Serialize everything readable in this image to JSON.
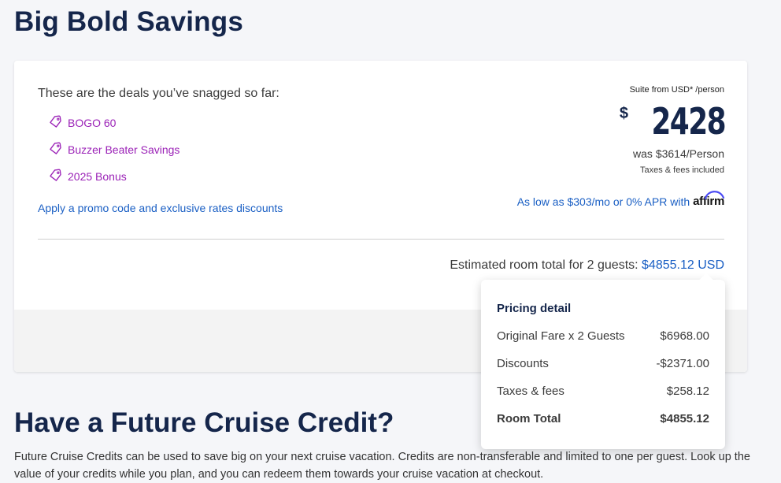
{
  "page": {
    "title": "Big Bold Savings"
  },
  "deals": {
    "intro": "These are the deals you’ve snagged so far:",
    "items": [
      {
        "label": "BOGO 60",
        "icon": "tag-icon"
      },
      {
        "label": "Buzzer Beater Savings",
        "icon": "tag-icon"
      },
      {
        "label": "2025 Bonus",
        "icon": "tag-icon"
      }
    ],
    "promo_link": "Apply a promo code and exclusive rates discounts"
  },
  "pricing": {
    "suite_from": "Suite from USD* /person",
    "currency_symbol": "$",
    "amount": "2428",
    "was": "was $3614/Person",
    "taxes_note": "Taxes & fees included",
    "affirm_text": "As low as $303/mo or 0% APR with",
    "affirm_logo": "affirm"
  },
  "estimate": {
    "label": "Estimated room total for 2 guests:",
    "total": "$4855.12 USD"
  },
  "pricing_detail": {
    "title": "Pricing detail",
    "rows": [
      {
        "label": "Original Fare x 2 Guests",
        "value": "$6968.00"
      },
      {
        "label": "Discounts",
        "value": "-$2371.00"
      },
      {
        "label": "Taxes & fees",
        "value": "$258.12"
      },
      {
        "label": "Room Total",
        "value": "$4855.12"
      }
    ]
  },
  "future_credit": {
    "title": "Have a Future Cruise Credit?",
    "body": "Future Cruise Credits can be used to save big on your next cruise vacation. Credits are non-transferable and limited to one per guest. Look up the value of your credits while you plan, and you can redeem them towards your cruise vacation at checkout."
  },
  "colors": {
    "navy": "#15264b",
    "link_blue": "#1a5fc4",
    "deal_purple": "#9b22b7",
    "affirm_blue": "#4a4af4"
  }
}
